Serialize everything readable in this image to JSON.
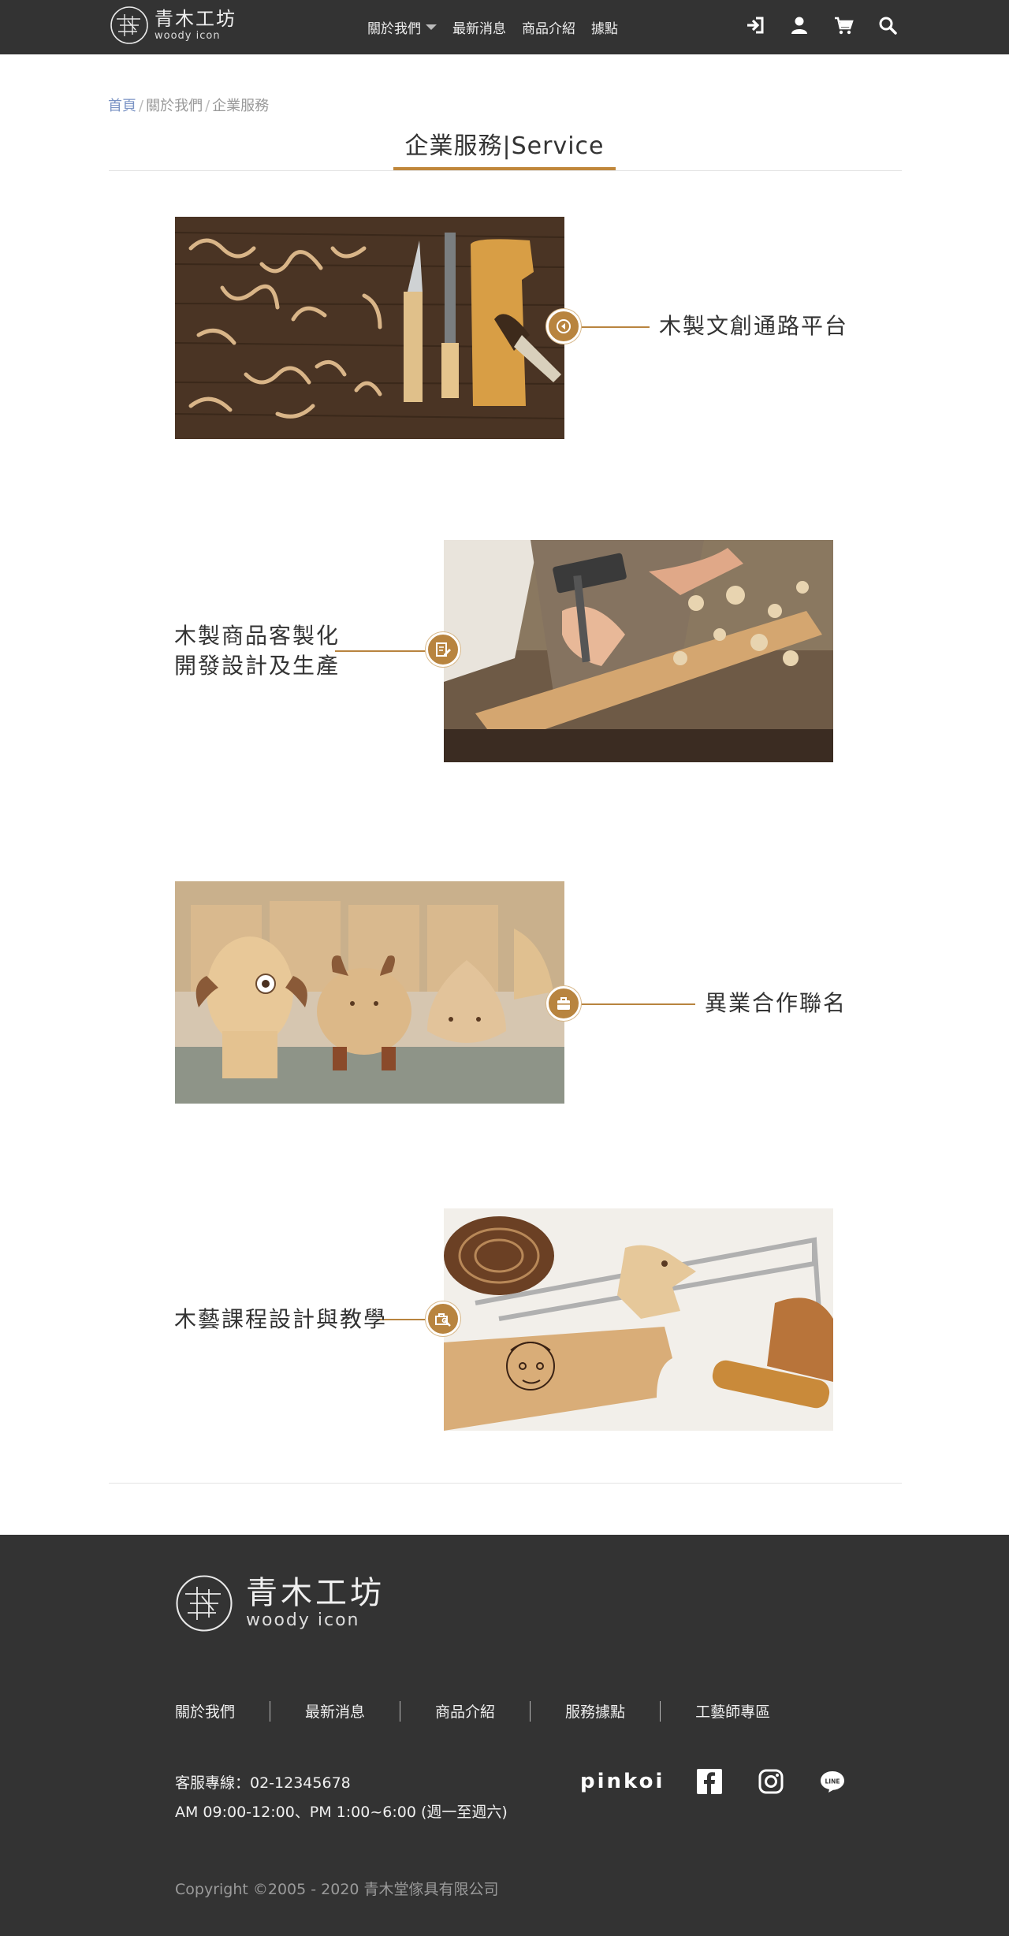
{
  "header": {
    "logo": {
      "zh": "青木工坊",
      "en": "woody icon"
    },
    "nav": [
      {
        "label": "關於我們",
        "has_dropdown": true
      },
      {
        "label": "最新消息"
      },
      {
        "label": "商品介紹"
      },
      {
        "label": "據點"
      }
    ],
    "icons": [
      "login-icon",
      "user-icon",
      "cart-icon",
      "search-icon"
    ]
  },
  "breadcrumb": {
    "items": [
      "首頁",
      "關於我們",
      "企業服務"
    ],
    "separator": "/"
  },
  "page": {
    "title": "企業服務|Service",
    "accent_color": "#c0873b"
  },
  "services": [
    {
      "label_lines": [
        "木製文創通路平台"
      ],
      "icon": "arrow-circle-icon",
      "image": "wood-shavings-tools-photo"
    },
    {
      "label_lines": [
        "木製商品客製化",
        "開發設計及生產"
      ],
      "icon": "edit-document-icon",
      "image": "hammer-woodworking-photo"
    },
    {
      "label_lines": [
        "異業合作聯名"
      ],
      "icon": "briefcase-icon",
      "image": "wooden-characters-photo"
    },
    {
      "label_lines": [
        "木藝課程設計與教學"
      ],
      "icon": "toolbox-icon",
      "image": "fret-saw-wood-crafts-photo"
    }
  ],
  "footer": {
    "logo": {
      "zh": "青木工坊",
      "en": "woody icon"
    },
    "links": [
      "關於我們",
      "最新消息",
      "商品介紹",
      "服務據點",
      "工藝師專區"
    ],
    "phone": "客服專線：02-12345678",
    "hours": "AM 09:00-12:00、PM 1:00~6:00 (週一至週六)",
    "social": {
      "pinkoi": "pinkoi",
      "icons": [
        "facebook-icon",
        "instagram-icon",
        "line-icon"
      ]
    },
    "copyright": "Copyright ©2005 - 2020 青木堂傢具有限公司"
  },
  "colors": {
    "header_bg": "#333333",
    "footer_bg": "#333333",
    "accent": "#b8843f",
    "breadcrumb_link": "#7a93c4"
  }
}
